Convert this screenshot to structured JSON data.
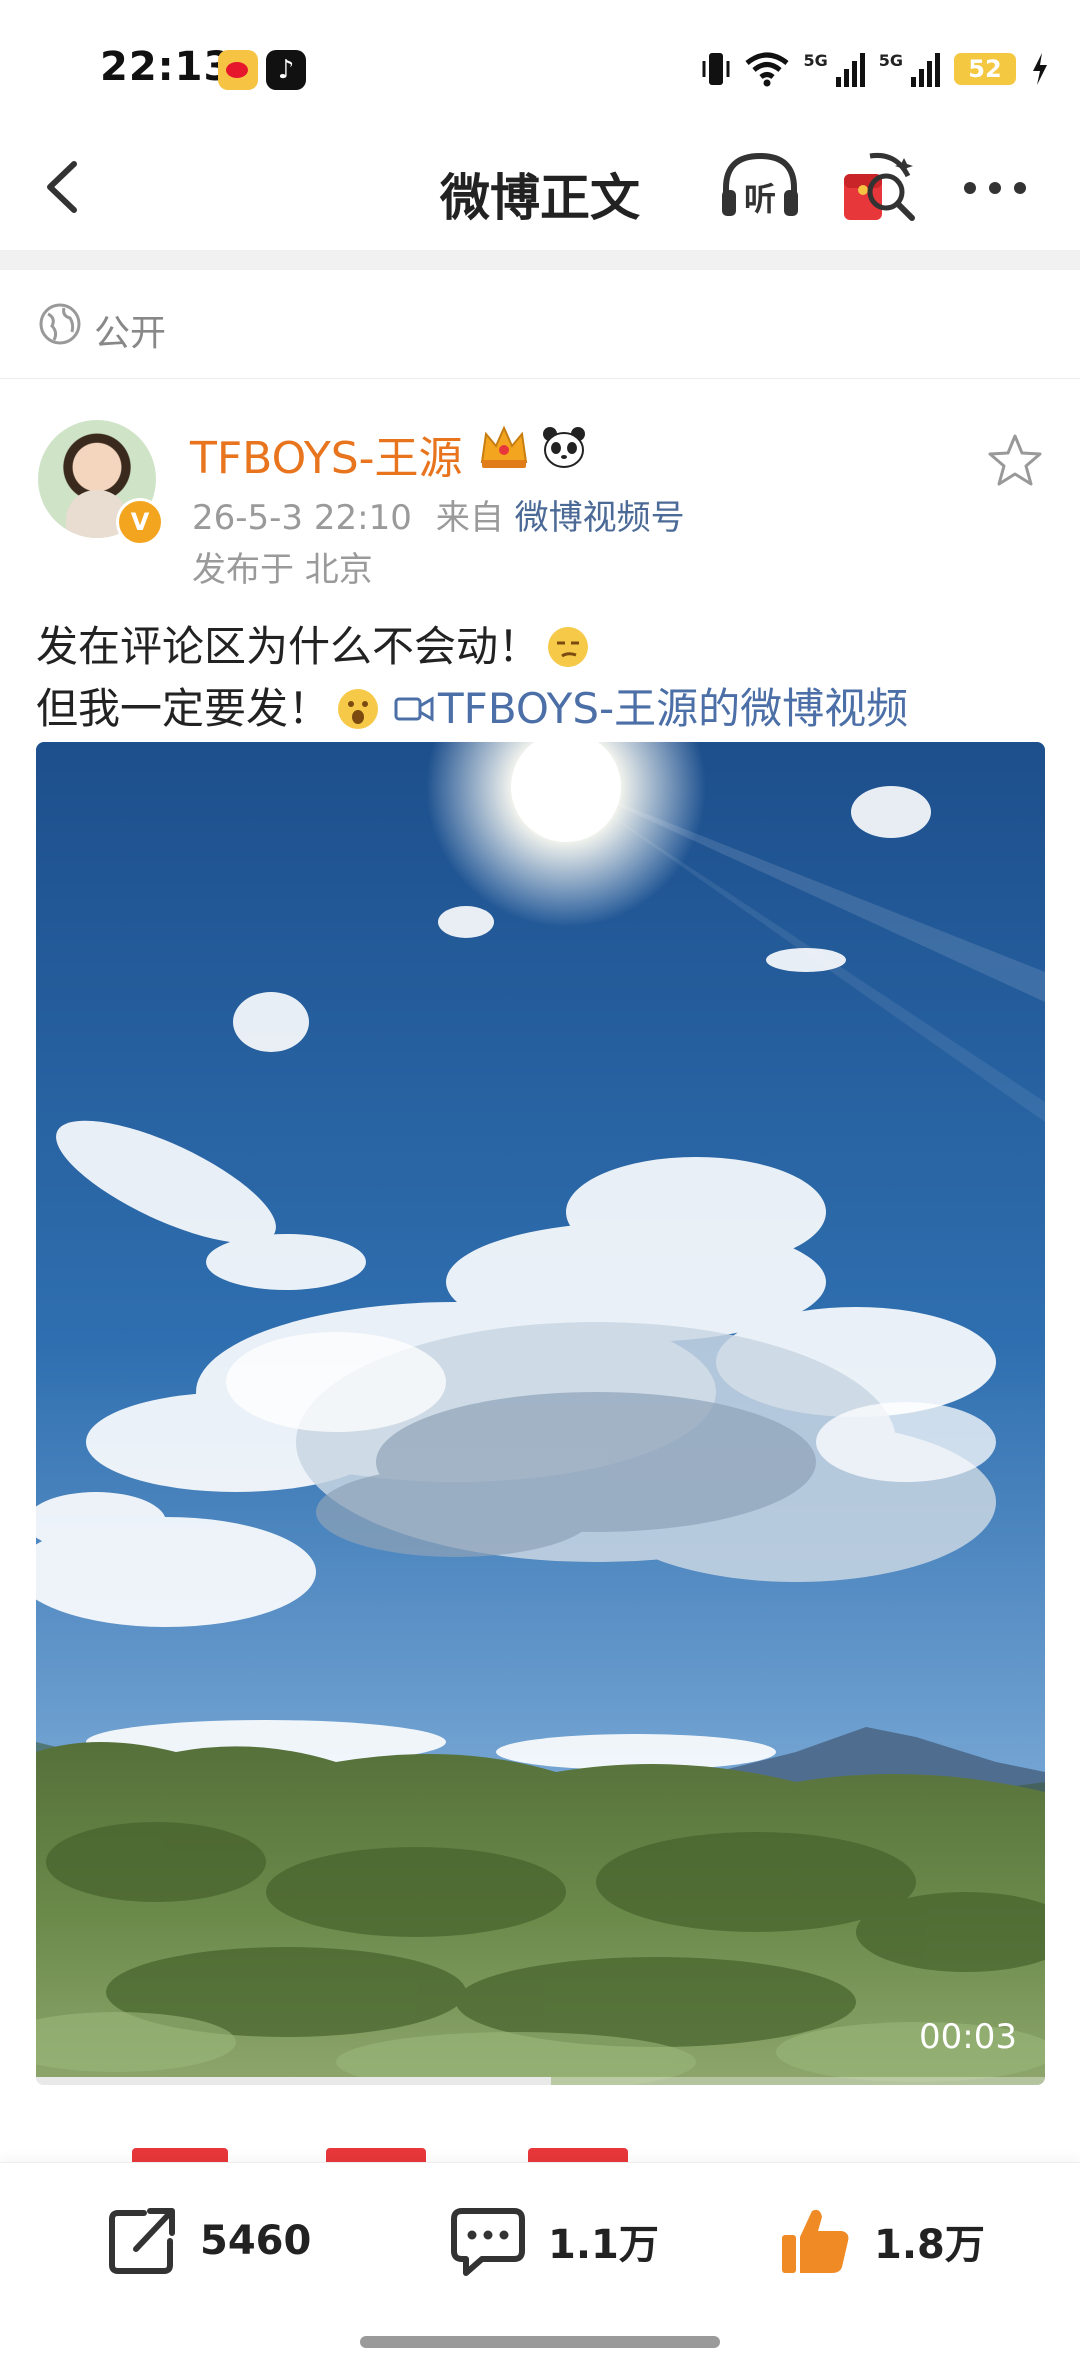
{
  "status_bar": {
    "time": "22:13",
    "network_label": "5G",
    "battery": "52"
  },
  "nav": {
    "title": "微博正文",
    "listen_label": "听"
  },
  "visibility": {
    "label": "公开"
  },
  "post": {
    "author": "TFBOYS-王源",
    "verified_mark": "V",
    "date": "26-5-3 22:10",
    "source_prefix": "来自",
    "source": "微博视频号",
    "location": "发布于 北京",
    "line1": "发在评论区为什么不会动！",
    "line2": "但我一定要发！",
    "video_link": "TFBOYS-王源的微博视频"
  },
  "video": {
    "duration": "00:03",
    "progress": 0.51
  },
  "actions": {
    "repost_count": "5460",
    "comment_count": "1.1万",
    "like_count": "1.8万"
  },
  "colors": {
    "author": "#e8751e",
    "link": "#4b6fa6",
    "like": "#f08a24",
    "badge": "#f3a51f"
  }
}
